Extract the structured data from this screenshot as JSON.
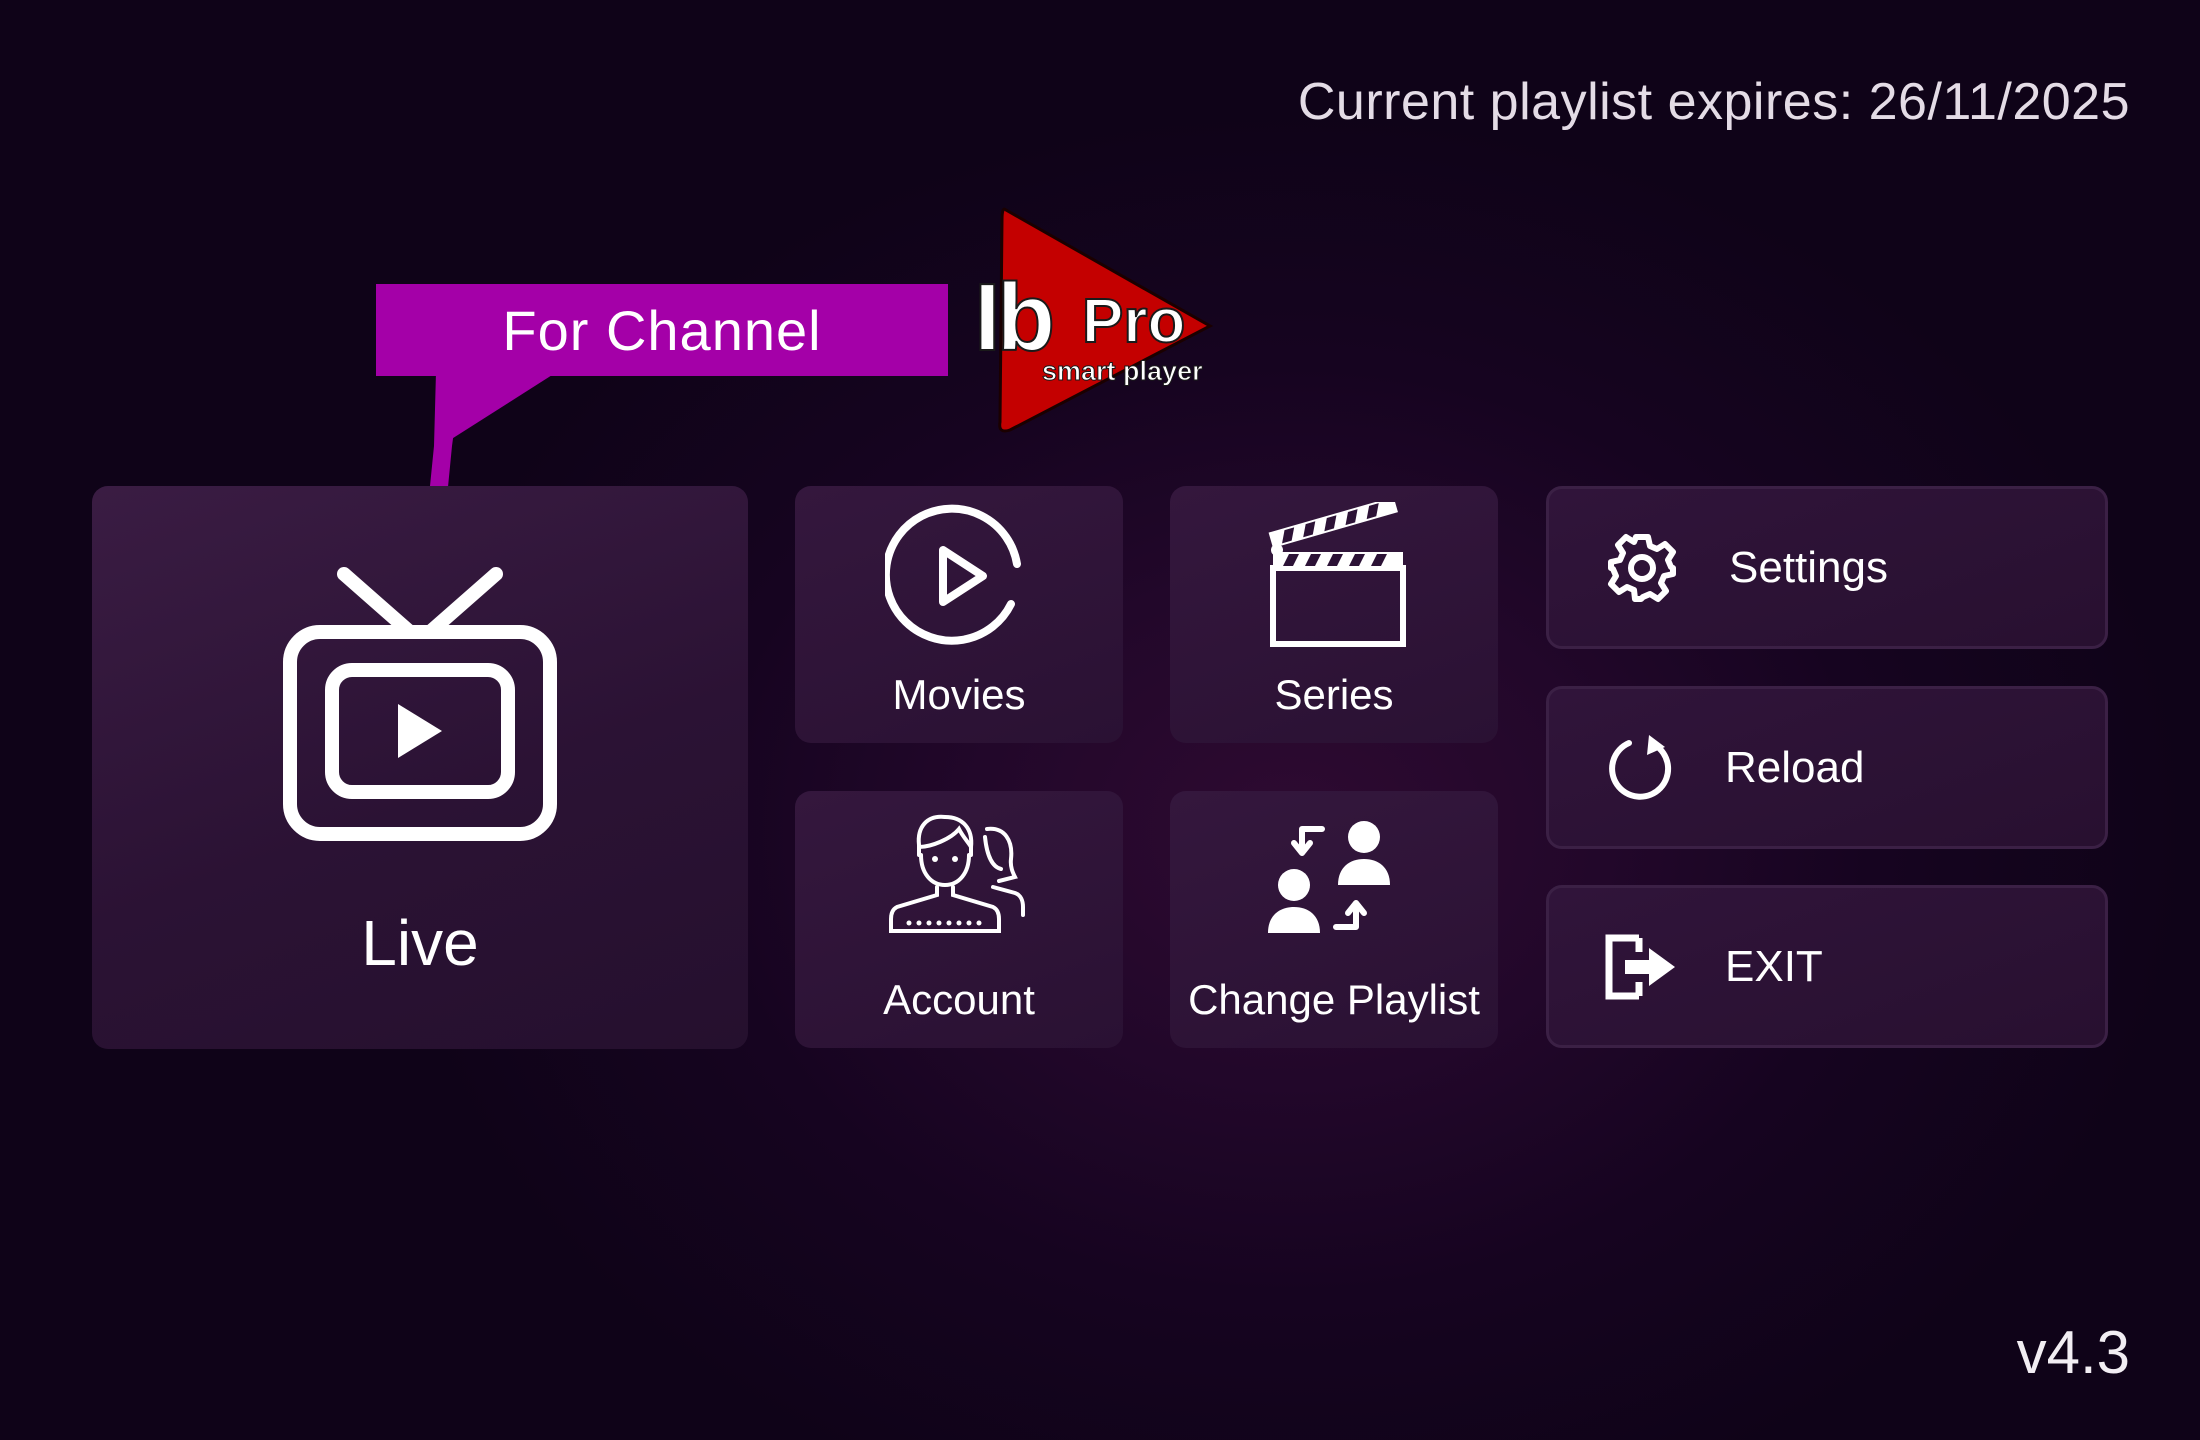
{
  "header": {
    "expiry_text": "Current playlist expires: 26/11/2025"
  },
  "logo": {
    "wordmark": "IbPro",
    "tagline": "smart player",
    "brand_color": "#c00000"
  },
  "callout": {
    "text": "For Channel",
    "color": "#a400a8"
  },
  "tiles": {
    "live": {
      "label": "Live",
      "icon": "tv-play-icon"
    },
    "movies": {
      "label": "Movies",
      "icon": "play-circle-icon"
    },
    "series": {
      "label": "Series",
      "icon": "clapperboard-icon"
    },
    "account": {
      "label": "Account",
      "icon": "users-icon"
    },
    "change_playlist": {
      "label": "Change Playlist",
      "icon": "switch-user-icon"
    },
    "settings": {
      "label": "Settings",
      "icon": "gear-icon"
    },
    "reload": {
      "label": "Reload",
      "icon": "reload-icon"
    },
    "exit": {
      "label": "EXIT",
      "icon": "exit-icon"
    }
  },
  "footer": {
    "version": "v4.3"
  },
  "colors": {
    "background": "#160420",
    "tile": "#2c1236",
    "text": "#ffffff"
  }
}
